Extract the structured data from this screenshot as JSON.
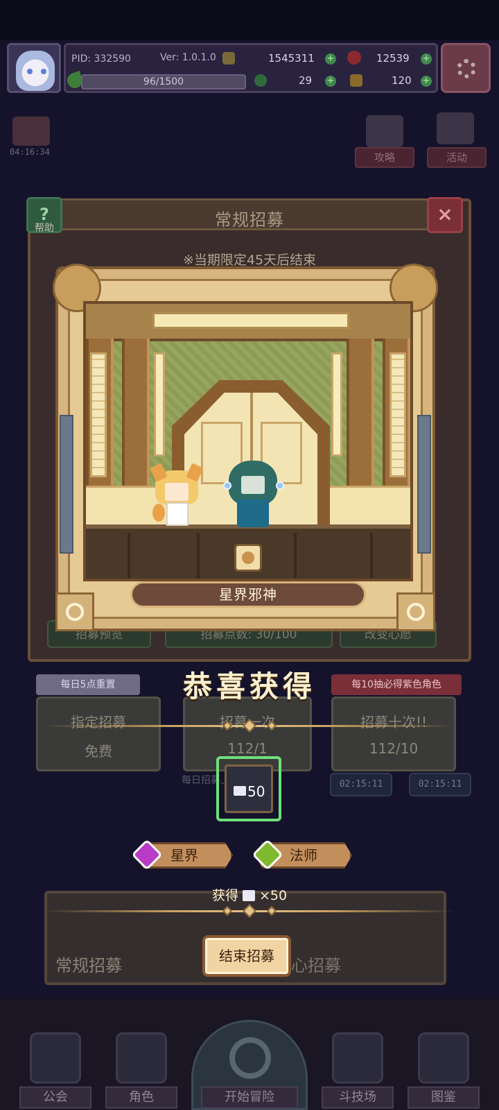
{
  "header": {
    "pid": "PID: 332590",
    "version": "Ver: 1.0.1.0",
    "gold": "1545311",
    "gems": "12539",
    "clover": "29",
    "hand": "120",
    "stamina": "96/1500"
  },
  "background": {
    "chest_timer": "04:16:34",
    "strategy_label": "攻略",
    "event_label": "活动",
    "help_label": "帮助",
    "recruit_title": "常规招募",
    "limit_notice": "※当期限定45天后结束",
    "recruit_preview": "招募预览",
    "recruit_points": "招募点数: 30/100",
    "change_wish": "改变心愿",
    "daily_reset": "每日5点重置",
    "ten_pull_note": "每10抽必得紫色角色",
    "action_left_title": "指定招募",
    "action_left_sub": "免费",
    "action_mid_title": "招募一次",
    "action_mid_sub": "112/1",
    "action_right_title": "招募十次!!",
    "action_right_sub": "112/10",
    "daily_limit": "每日招募上限9999",
    "timer_a": "02:15:11",
    "timer_b": "02:15:11",
    "banner_left": "常规招募",
    "banner_right": "心招募"
  },
  "reward": {
    "character_name": "星界邪神",
    "congrats": "恭喜获得",
    "item_count": "50",
    "tag_astral": "星界",
    "tag_mage": "法师",
    "obtained_prefix": "获得",
    "obtained_suffix": "×50",
    "end_button": "结束招募"
  },
  "nav": {
    "guild": "公会",
    "character": "角色",
    "adventure": "开始冒险",
    "arena": "斗技场",
    "codex": "图鉴"
  },
  "colors": {
    "highlight_green": "#6fe07a",
    "astral_gem": "#b93bc7",
    "mage_gem": "#7fb92f",
    "title_cream": "#fff1cf"
  }
}
